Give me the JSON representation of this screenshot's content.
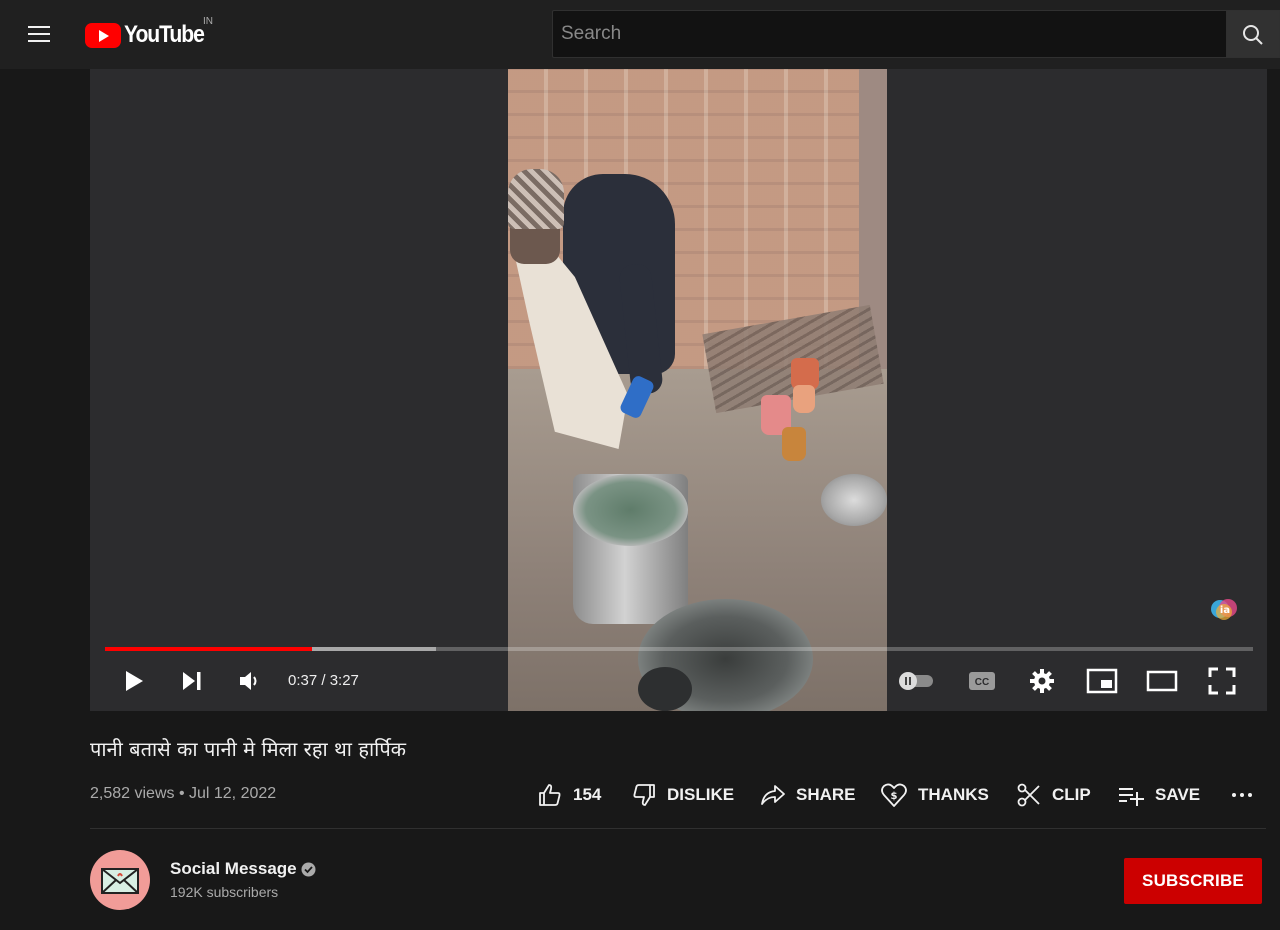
{
  "header": {
    "logo_text": "YouTube",
    "country_code": "IN",
    "search_placeholder": "Search"
  },
  "player": {
    "current_time": "0:37",
    "duration": "3:27",
    "time_display": "0:37 / 3:27",
    "played_fraction": 0.18,
    "buffered_fraction": 0.288
  },
  "video": {
    "title": "पानी बतासे का पानी मे मिला रहा था हार्पिक",
    "views": "2,582 views",
    "date": "Jul 12, 2022",
    "meta": "2,582 views • Jul 12, 2022"
  },
  "actions": {
    "likes": "154",
    "dislike": "DISLIKE",
    "share": "SHARE",
    "thanks": "THANKS",
    "clip": "CLIP",
    "save": "SAVE"
  },
  "channel": {
    "name": "Social Message",
    "subscribers": "192K subscribers",
    "subscribe_label": "SUBSCRIBE"
  },
  "colors": {
    "brand_red": "#ff0000",
    "subscribe_red": "#cc0000",
    "background": "#181818",
    "header": "#202020"
  },
  "icons": [
    "menu-icon",
    "youtube-logo-icon",
    "search-icon",
    "play-icon",
    "next-icon",
    "volume-icon",
    "autoplay-toggle-icon",
    "captions-icon",
    "settings-icon",
    "miniplayer-icon",
    "theater-icon",
    "fullscreen-icon",
    "like-icon",
    "dislike-icon",
    "share-icon",
    "thanks-icon",
    "clip-icon",
    "save-icon",
    "more-icon",
    "verified-icon"
  ]
}
